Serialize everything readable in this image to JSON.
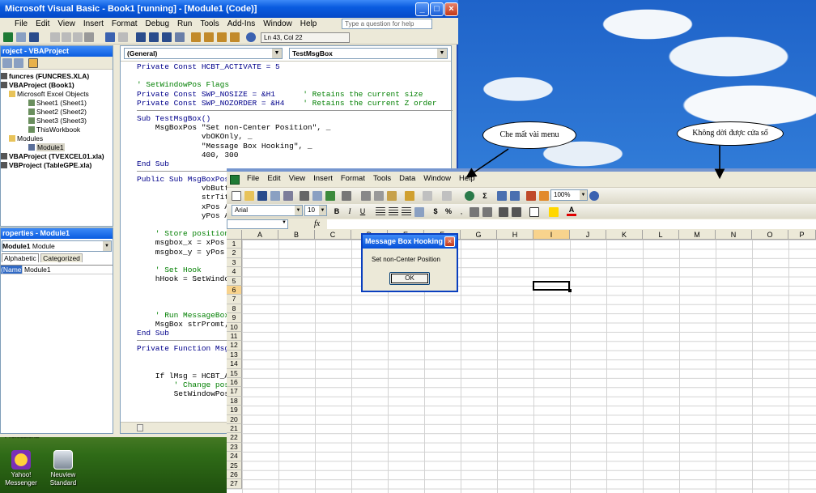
{
  "vba": {
    "title": "Microsoft Visual Basic - Book1 [running] - [Module1 (Code)]",
    "menu": [
      "File",
      "Edit",
      "View",
      "Insert",
      "Format",
      "Debug",
      "Run",
      "Tools",
      "Add-Ins",
      "Window",
      "Help"
    ],
    "help_placeholder": "Type a question for help",
    "cursor_pos": "Ln 43, Col 22",
    "project_title": "roject - VBAProject",
    "tree": [
      "funcres (FUNCRES.XLA)",
      "VBAProject (Book1)",
      "Microsoft Excel Objects",
      "Sheet1 (Sheet1)",
      "Sheet2 (Sheet2)",
      "Sheet3 (Sheet3)",
      "ThisWorkbook",
      "Modules",
      "Module1",
      "VBAProject (TVEXCEL01.xla)",
      "VBProject (TableGPE.xla)"
    ],
    "props_title": "roperties - Module1",
    "props_object": "Module1",
    "props_type": "Module",
    "props_tabs": [
      "Alphabetic",
      "Categorized"
    ],
    "props_name_key": "(Name)",
    "props_name_val": "Module1",
    "combo_object": "(General)",
    "combo_proc": "TestMsgBox",
    "code": [
      [
        "kw",
        "Private Const HCBT_ACTIVATE = 5"
      ],
      [
        "",
        ""
      ],
      [
        "cm",
        "' SetWindowPos Flags"
      ],
      [
        "kw",
        "Private Const SWP_NOSIZE = &H1      ",
        "cm",
        "' Retains the current size"
      ],
      [
        "kw",
        "Private Const SWP_NOZORDER = &H4    ",
        "cm",
        "' Retains the current Z order"
      ],
      [
        "sep"
      ],
      [
        "kw",
        "Sub TestMsgBox()"
      ],
      [
        "",
        "    MsgBoxPos \"Set non-Center Position\", _"
      ],
      [
        "",
        "              vbOKOnly, _"
      ],
      [
        "",
        "              \"Message Box Hooking\", _"
      ],
      [
        "",
        "              400, 300"
      ],
      [
        "kw",
        "End Sub"
      ],
      [
        "sep"
      ],
      [
        "kw",
        "Public Sub MsgBoxPos"
      ],
      [
        "",
        "              vbButt"
      ],
      [
        "",
        "              strTit"
      ],
      [
        "",
        "              xPos A"
      ],
      [
        "",
        "              yPos A"
      ],
      [
        "",
        ""
      ],
      [
        "cm",
        "    ' Store position"
      ],
      [
        "",
        "    msgbox_x = xPos"
      ],
      [
        "",
        "    msgbox_y = yPos"
      ],
      [
        "",
        ""
      ],
      [
        "cm",
        "    ' Set Hook"
      ],
      [
        "",
        "    hHook = SetWindo"
      ],
      [
        "",
        ""
      ],
      [
        "",
        ""
      ],
      [
        "",
        ""
      ],
      [
        "cm",
        "    ' Run MessageBox"
      ],
      [
        "",
        "    MsgBox strPromt,"
      ],
      [
        "kw",
        "End Sub"
      ],
      [
        "sep"
      ],
      [
        "kw",
        "Private Function Msg"
      ],
      [
        "",
        ""
      ],
      [
        "",
        ""
      ],
      [
        "",
        "    If lMsg = HCBT_A"
      ],
      [
        "cm",
        "        ' Change pos"
      ],
      [
        "",
        "        SetWindowPos"
      ]
    ]
  },
  "excel": {
    "menu": [
      "File",
      "Edit",
      "View",
      "Insert",
      "Format",
      "Tools",
      "Data",
      "Window",
      "Help"
    ],
    "zoom": "100%",
    "font": "Arial",
    "size": "10",
    "fx": "fx",
    "columns": [
      "A",
      "B",
      "C",
      "D",
      "E",
      "F",
      "G",
      "H",
      "I",
      "J",
      "K",
      "L",
      "M",
      "N",
      "O",
      "P"
    ],
    "rows": [
      "1",
      "2",
      "3",
      "4",
      "5",
      "6",
      "7",
      "8",
      "9",
      "10",
      "11",
      "12",
      "13",
      "14",
      "15",
      "16",
      "17",
      "18",
      "19",
      "20",
      "21",
      "22",
      "23",
      "24",
      "25",
      "26",
      "27"
    ]
  },
  "msgbox": {
    "title": "Message Box Hooking",
    "text": "Set non-Center Position",
    "ok": "OK"
  },
  "callouts": {
    "menu": "Che mất vài menu",
    "window": "Không dời được cửa sổ"
  },
  "desktop": {
    "icon1": "Yahoo! Messenger",
    "icon2": "Neuview Standard",
    "partial": "Professiona"
  }
}
